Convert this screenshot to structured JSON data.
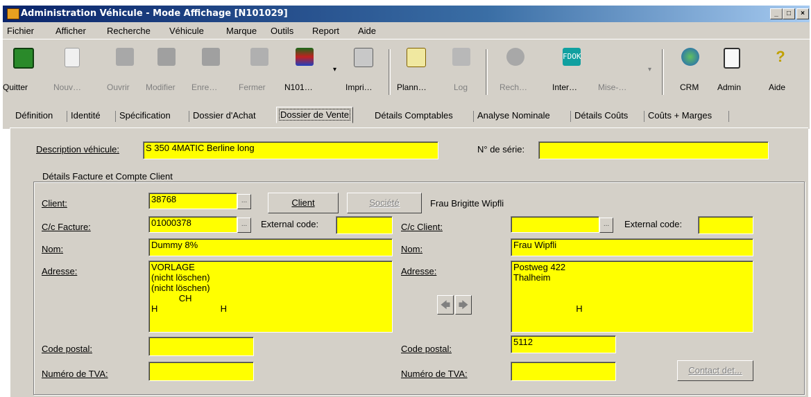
{
  "window": {
    "title": "Administration Véhicule - Mode Affichage [N101029]",
    "minimize": "_",
    "maximize": "□",
    "close": "×"
  },
  "menu": [
    "Fichier",
    "Afficher",
    "Recherche",
    "Véhicule",
    "Marque",
    "Outils",
    "Report",
    "Aide"
  ],
  "toolbar": [
    {
      "label": "Quitter",
      "icon": "exit-icon",
      "enabled": true
    },
    {
      "label": "Nouv…",
      "icon": "new-document-icon",
      "enabled": false
    },
    {
      "label": "Ouvrir",
      "icon": "open-folder-icon",
      "enabled": false
    },
    {
      "label": "Modifier",
      "icon": "edit-icon",
      "enabled": false
    },
    {
      "label": "Enre…",
      "icon": "save-icon",
      "enabled": false
    },
    {
      "label": "Fermer",
      "icon": "close-folder-icon",
      "enabled": false
    },
    {
      "label": "N101…",
      "icon": "car-icon",
      "enabled": true
    },
    {
      "label": "Impri…",
      "icon": "printer-icon",
      "enabled": true
    },
    {
      "label": "Plann…",
      "icon": "planner-icon",
      "enabled": true
    },
    {
      "label": "Log",
      "icon": "log-icon",
      "enabled": false
    },
    {
      "label": "Rech…",
      "icon": "search-icon",
      "enabled": false
    },
    {
      "label": "Inter…",
      "icon": "fdok-icon",
      "enabled": true
    },
    {
      "label": "Mise-…",
      "icon": "update-icon",
      "enabled": false
    },
    {
      "label": "CRM",
      "icon": "crm-globe-icon",
      "enabled": true
    },
    {
      "label": "Admin",
      "icon": "admin-icon",
      "enabled": true
    },
    {
      "label": "Aide",
      "icon": "help-icon",
      "enabled": true
    }
  ],
  "fdok_text": "FDOK",
  "tabs": [
    "Définition",
    "Identité",
    "Spécification",
    "Dossier d'Achat",
    "Dossier de Vente",
    "Détails Comptables",
    "Analyse Nominale",
    "Détails Coûts",
    "Coûts + Marges"
  ],
  "active_tab": "Dossier de Vente",
  "form": {
    "description_label": "Description véhicule:",
    "description_value": "S 350 4MATIC Berline long",
    "serial_label": "N° de série:",
    "serial_value": "",
    "group_title": "Détails Facture et Compte Client",
    "client_label": "Client:",
    "client_value": "38768",
    "client_button": "Client",
    "company_button": "Société",
    "client_name": "Frau Brigitte Wipfli",
    "invoice_account_label": "C/c Facture:",
    "invoice_account_value": "01000378",
    "external_code_label": "External code:",
    "external_code_left_value": "",
    "client_account_label": "C/c Client:",
    "client_account_value": "",
    "external_code_right_value": "",
    "name_label": "Nom:",
    "name_left_value": "Dummy 8%",
    "name_right_value": "Frau Wipfli",
    "address_label": "Adresse:",
    "address_left_value": "VORLAGE\n(nicht löschen)\n(nicht löschen)\n           CH\nH                         H",
    "address_right_value": "Postweg 422\nThalheim\n\n\n                         H",
    "postal_label": "Code postal:",
    "postal_left_value": "",
    "postal_right_value": "5112",
    "vat_label": "Numéro de TVA:",
    "vat_left_value": "",
    "vat_right_value": "",
    "contact_button": "Contact det...",
    "ellipsis": "...",
    "arrow_left": "🡄",
    "arrow_right": "🡆"
  },
  "colors": {
    "field": "#ffff00",
    "face": "#d4d0c8",
    "title_start": "#0a246a",
    "title_end": "#a6caf0"
  }
}
